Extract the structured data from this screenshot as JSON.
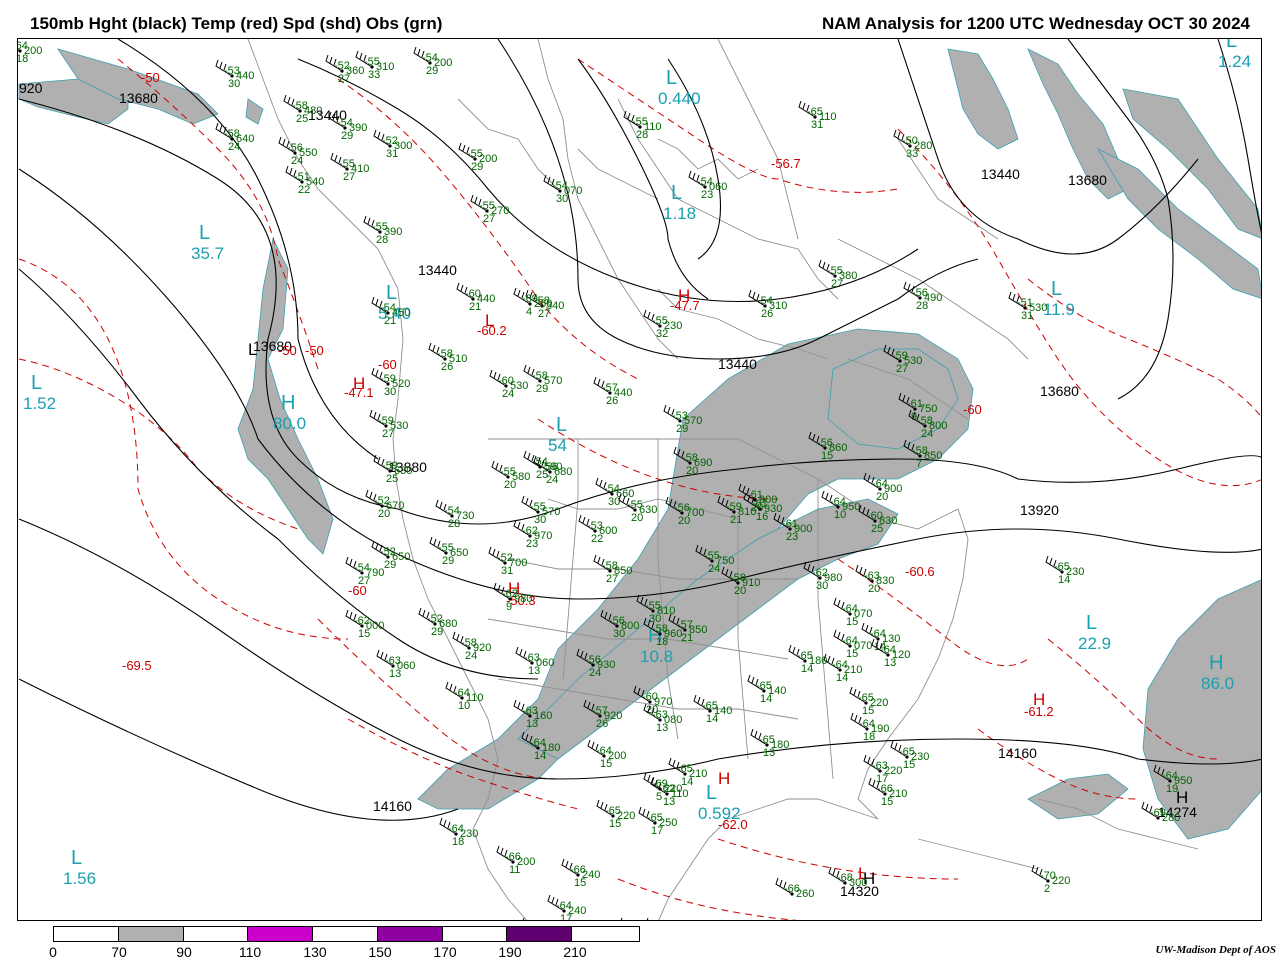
{
  "header": {
    "left_title": "150mb Hght (black) Temp (red) Spd (shd) Obs (grn)",
    "right_title": "NAM Analysis for 1200 UTC Wednesday  OCT 30 2024"
  },
  "colors": {
    "height_contour": "#000000",
    "temperature_contour": "#cc0000",
    "speed_shade_70_90": "#b0b0b0",
    "obs_green": "#006400",
    "pressure_center_label": "#1aa0b0",
    "geography": "#909090"
  },
  "colorbar": {
    "ticks": [
      "0",
      "70",
      "90",
      "110",
      "130",
      "150",
      "170",
      "190",
      "210"
    ],
    "segment_colors": [
      "#ffffff",
      "#b0b0b0",
      "#ffffff",
      "#cc00cc",
      "#ffffff",
      "#9000a0",
      "#ffffff",
      "#600070",
      "#ffffff"
    ]
  },
  "height_labels": [
    "13680",
    "13440",
    "13440",
    "13680",
    "13440",
    "13680",
    "13440",
    "13680",
    "13920",
    "14160",
    "14160",
    "920",
    "14274",
    "14320",
    "13880"
  ],
  "temp_labels": [
    "-50",
    "-50",
    "-50",
    "-56.7",
    "-47.7",
    "-60.2",
    "-47.1",
    "-69.5",
    "-50.3",
    "-60",
    "-60",
    "-60.6",
    "-61.2",
    "-62.0",
    "-60"
  ],
  "centers": [
    {
      "letter": "L",
      "value": "35.7"
    },
    {
      "letter": "L",
      "value": "1.52"
    },
    {
      "letter": "H",
      "value": "80.0"
    },
    {
      "letter": "L",
      "value": "5.40"
    },
    {
      "letter": "L",
      "value": "1.18"
    },
    {
      "letter": "L",
      "value": "11.9"
    },
    {
      "letter": "L",
      "value": "22.9"
    },
    {
      "letter": "H",
      "value": "86.0"
    },
    {
      "letter": "L",
      "value": "1.56"
    },
    {
      "letter": "L",
      "value": "0.592"
    },
    {
      "letter": "L",
      "value": "0.440"
    },
    {
      "letter": "L",
      "value": "1.24"
    },
    {
      "letter": "L",
      "value": "54"
    },
    {
      "letter": "H",
      "value": "10.8"
    }
  ],
  "red_center_letters": [
    "H",
    "L",
    "H",
    "H",
    "H",
    "H",
    "L"
  ],
  "black_center_letters": [
    "H",
    "H",
    "L"
  ],
  "observations": [
    {
      "temp": "-53",
      "hgt": "440",
      "dpd": "30"
    },
    {
      "temp": "-58",
      "hgt": "480",
      "dpd": "25"
    },
    {
      "temp": "-58",
      "hgt": "640",
      "dpd": "24"
    },
    {
      "temp": "-56",
      "hgt": "550",
      "dpd": "24"
    },
    {
      "temp": "-51",
      "hgt": "540",
      "dpd": "22"
    },
    {
      "temp": "-54",
      "hgt": "390",
      "dpd": "29"
    },
    {
      "temp": "-55",
      "hgt": "410",
      "dpd": "27"
    },
    {
      "temp": "-52",
      "hgt": "300",
      "dpd": "31"
    },
    {
      "temp": "-54",
      "hgt": "200",
      "dpd": "29"
    },
    {
      "temp": "-52",
      "hgt": "360",
      "dpd": "27"
    },
    {
      "temp": "-55",
      "hgt": "310",
      "dpd": "33"
    },
    {
      "temp": "-55",
      "hgt": "200",
      "dpd": "29"
    },
    {
      "temp": "-55",
      "hgt": "270",
      "dpd": "27"
    },
    {
      "temp": "-54",
      "hgt": "070",
      "dpd": "30"
    },
    {
      "temp": "-55",
      "hgt": "110",
      "dpd": "28"
    },
    {
      "temp": "-65",
      "hgt": "110",
      "dpd": "31"
    },
    {
      "temp": "-50",
      "hgt": "280",
      "dpd": "33"
    },
    {
      "temp": "-54",
      "hgt": "060",
      "dpd": "23"
    },
    {
      "temp": "-55",
      "hgt": "380",
      "dpd": "27"
    },
    {
      "temp": "-56",
      "hgt": "490",
      "dpd": "28"
    },
    {
      "temp": "-51",
      "hgt": "530",
      "dpd": "31"
    },
    {
      "temp": "-55",
      "hgt": "390",
      "dpd": "28"
    },
    {
      "temp": "-54",
      "hgt": "450",
      "dpd": "21"
    },
    {
      "temp": "-60",
      "hgt": "440",
      "dpd": "21"
    },
    {
      "temp": "-58",
      "hgt": "340",
      "dpd": "27"
    },
    {
      "temp": "-54",
      "hgt": "310",
      "dpd": "26"
    },
    {
      "temp": "-55",
      "hgt": "230",
      "dpd": "32"
    },
    {
      "temp": "-58",
      "hgt": "510",
      "dpd": "26"
    },
    {
      "temp": "-59",
      "hgt": "520",
      "dpd": "30"
    },
    {
      "temp": "-60",
      "hgt": "530",
      "dpd": "24"
    },
    {
      "temp": "-57",
      "hgt": "440",
      "dpd": "26"
    },
    {
      "temp": "-59",
      "hgt": "530",
      "dpd": "27"
    },
    {
      "temp": "-59",
      "hgt": "630",
      "dpd": "25"
    },
    {
      "temp": "-53",
      "hgt": "570",
      "dpd": "29"
    },
    {
      "temp": "-54",
      "hgt": "590",
      "dpd": "25"
    },
    {
      "temp": "-56",
      "hgt": "680",
      "dpd": "24"
    },
    {
      "temp": "-61",
      "hgt": "750",
      "dpd": "9"
    },
    {
      "temp": "-58",
      "hgt": "800",
      "dpd": "24"
    },
    {
      "temp": "-56",
      "hgt": "860",
      "dpd": "15"
    },
    {
      "temp": "-58",
      "hgt": "850",
      "dpd": "7"
    },
    {
      "temp": "-58",
      "hgt": "690",
      "dpd": "20"
    },
    {
      "temp": "-55",
      "hgt": "580",
      "dpd": "20"
    },
    {
      "temp": "-55",
      "hgt": "570",
      "dpd": "30"
    },
    {
      "temp": "-52",
      "hgt": "670",
      "dpd": "20"
    },
    {
      "temp": "-54",
      "hgt": "730",
      "dpd": "28"
    },
    {
      "temp": "-54",
      "hgt": "660",
      "dpd": "30"
    },
    {
      "temp": "-55",
      "hgt": "630",
      "dpd": "20"
    },
    {
      "temp": "-56",
      "hgt": "700",
      "dpd": "20"
    },
    {
      "temp": "-59",
      "hgt": "810",
      "dpd": "21"
    },
    {
      "temp": "-61",
      "hgt": "900",
      "dpd": "20"
    },
    {
      "temp": "-64",
      "hgt": "900",
      "dpd": "20"
    },
    {
      "temp": "-64",
      "hgt": "950",
      "dpd": "10"
    },
    {
      "temp": "-61",
      "hgt": "930",
      "dpd": "16"
    },
    {
      "temp": "-62",
      "hgt": "970",
      "dpd": "23"
    },
    {
      "temp": "-53",
      "hgt": "600",
      "dpd": "22"
    },
    {
      "temp": "-55",
      "hgt": "650",
      "dpd": "29"
    },
    {
      "temp": "-52",
      "hgt": "700",
      "dpd": "31"
    },
    {
      "temp": "-52",
      "hgt": "650",
      "dpd": "29"
    },
    {
      "temp": "-54",
      "hgt": "790",
      "dpd": "27"
    },
    {
      "temp": "-58",
      "hgt": "850",
      "dpd": "27"
    },
    {
      "temp": "-55",
      "hgt": "750",
      "dpd": "24"
    },
    {
      "temp": "-61",
      "hgt": "900",
      "dpd": "23"
    },
    {
      "temp": "-62",
      "hgt": "980",
      "dpd": "9"
    },
    {
      "temp": "-62",
      "hgt": "000",
      "dpd": "15"
    },
    {
      "temp": "-52",
      "hgt": "680",
      "dpd": "29"
    },
    {
      "temp": "-58",
      "hgt": "920",
      "dpd": "24"
    },
    {
      "temp": "-56",
      "hgt": "800",
      "dpd": "30"
    },
    {
      "temp": "-55",
      "hgt": "810",
      "dpd": "30"
    },
    {
      "temp": "-58",
      "hgt": "910",
      "dpd": "20"
    },
    {
      "temp": "-62",
      "hgt": "980",
      "dpd": "30"
    },
    {
      "temp": "-63",
      "hgt": "830",
      "dpd": "20"
    },
    {
      "temp": "-63",
      "hgt": "060",
      "dpd": "13"
    },
    {
      "temp": "-63",
      "hgt": "060",
      "dpd": "13"
    },
    {
      "temp": "-56",
      "hgt": "930",
      "dpd": "24"
    },
    {
      "temp": "-57",
      "hgt": "850",
      "dpd": "21"
    },
    {
      "temp": "-58",
      "hgt": "960",
      "dpd": "18"
    },
    {
      "temp": "-64",
      "hgt": "070",
      "dpd": "15"
    },
    {
      "temp": "-64",
      "hgt": "070",
      "dpd": "15"
    },
    {
      "temp": "-64",
      "hgt": "130",
      "dpd": "14"
    },
    {
      "temp": "-64",
      "hgt": "120",
      "dpd": "13"
    },
    {
      "temp": "-64",
      "hgt": "110",
      "dpd": "10"
    },
    {
      "temp": "-63",
      "hgt": "160",
      "dpd": "13"
    },
    {
      "temp": "-57",
      "hgt": "920",
      "dpd": "26"
    },
    {
      "temp": "-60",
      "hgt": "970",
      "dpd": "20"
    },
    {
      "temp": "-63",
      "hgt": "080",
      "dpd": "13"
    },
    {
      "temp": "-65",
      "hgt": "140",
      "dpd": "14"
    },
    {
      "temp": "-65",
      "hgt": "140",
      "dpd": "14"
    },
    {
      "temp": "-65",
      "hgt": "180",
      "dpd": "14"
    },
    {
      "temp": "-64",
      "hgt": "210",
      "dpd": "14"
    },
    {
      "temp": "-64",
      "hgt": "180",
      "dpd": "14"
    },
    {
      "temp": "-64",
      "hgt": "200",
      "dpd": "15"
    },
    {
      "temp": "-65",
      "hgt": "210",
      "dpd": "14"
    },
    {
      "temp": "-62",
      "hgt": "110",
      "dpd": "13"
    },
    {
      "temp": "-65",
      "hgt": "180",
      "dpd": "13"
    },
    {
      "temp": "-65",
      "hgt": "220",
      "dpd": "15"
    },
    {
      "temp": "-65",
      "hgt": "230",
      "dpd": "15"
    },
    {
      "temp": "-64",
      "hgt": "190",
      "dpd": "18"
    },
    {
      "temp": "-63",
      "hgt": "220",
      "dpd": "17"
    },
    {
      "temp": "-66",
      "hgt": "210",
      "dpd": "15"
    },
    {
      "temp": "-65",
      "hgt": "230",
      "dpd": "14"
    },
    {
      "temp": "-64",
      "hgt": "950",
      "dpd": "19"
    },
    {
      "temp": "-69",
      "hgt": "220",
      "dpd": "5"
    },
    {
      "temp": "-65",
      "hgt": "220",
      "dpd": "15"
    },
    {
      "temp": "-65",
      "hgt": "250",
      "dpd": "17"
    },
    {
      "temp": "-64",
      "hgt": "230",
      "dpd": "18"
    },
    {
      "temp": "-66",
      "hgt": "200",
      "dpd": "11"
    },
    {
      "temp": "-66",
      "hgt": "240",
      "dpd": "15"
    },
    {
      "temp": "-64",
      "hgt": "240",
      "dpd": "17"
    },
    {
      "temp": "-66",
      "hgt": "260",
      "dpd": "12"
    },
    {
      "temp": "-67",
      "hgt": "280",
      "dpd": ""
    },
    {
      "temp": "-66",
      "hgt": "180",
      "dpd": ""
    },
    {
      "temp": "-66",
      "hgt": "260",
      "dpd": ""
    },
    {
      "temp": "-68",
      "hgt": "300",
      "dpd": ""
    },
    {
      "temp": "-69",
      "hgt": "280",
      "dpd": ""
    },
    {
      "temp": "-70",
      "hgt": "220",
      "dpd": "2"
    },
    {
      "temp": "-69",
      "hgt": "260",
      "dpd": "4"
    },
    {
      "temp": "-58",
      "hgt": "570",
      "dpd": "29"
    },
    {
      "temp": "-59",
      "hgt": "530",
      "dpd": "27"
    },
    {
      "temp": "-60",
      "hgt": "830",
      "dpd": "25"
    },
    {
      "temp": "-64",
      "hgt": "200",
      "dpd": "18"
    }
  ],
  "credit": "UW-Madison   Dept of AOS"
}
